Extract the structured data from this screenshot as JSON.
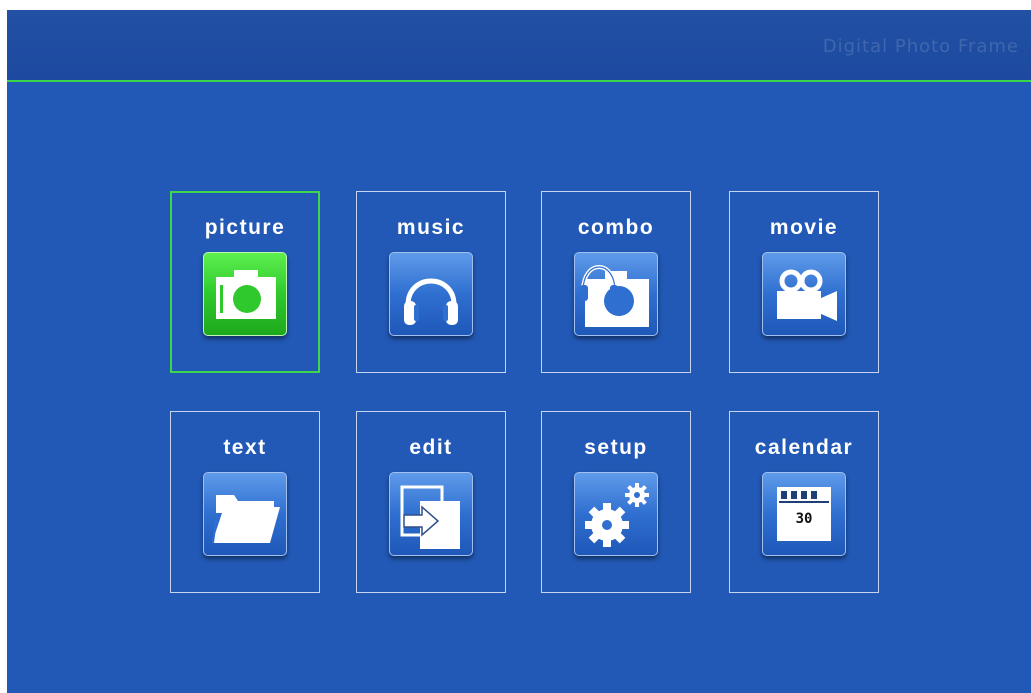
{
  "header": {
    "title": "Digital Photo Frame"
  },
  "menu": {
    "items": [
      {
        "label": "picture",
        "icon": "camera-icon",
        "selected": true
      },
      {
        "label": "music",
        "icon": "headphones-icon",
        "selected": false
      },
      {
        "label": "combo",
        "icon": "camera-headphones-icon",
        "selected": false
      },
      {
        "label": "movie",
        "icon": "video-camera-icon",
        "selected": false
      },
      {
        "label": "text",
        "icon": "folder-icon",
        "selected": false
      },
      {
        "label": "edit",
        "icon": "copy-arrow-icon",
        "selected": false
      },
      {
        "label": "setup",
        "icon": "gears-icon",
        "selected": false
      },
      {
        "label": "calendar",
        "icon": "calendar-icon",
        "selected": false
      }
    ],
    "calendar_day": "30"
  },
  "colors": {
    "background": "#2259b6",
    "header_line": "#38d74a",
    "selected": "#3ed64b",
    "tile_border": "#c7d4ef"
  }
}
